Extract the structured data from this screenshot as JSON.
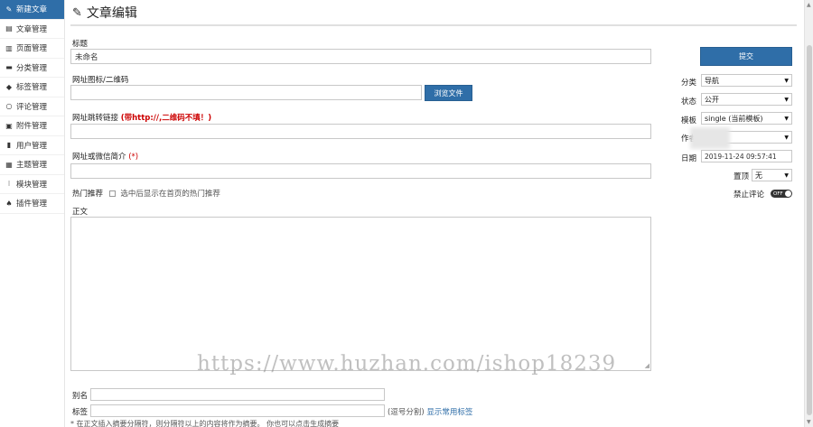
{
  "sidebar": {
    "items": [
      {
        "label": "新建文章",
        "icon": "pencil-icon"
      },
      {
        "label": "文章管理",
        "icon": "document-icon"
      },
      {
        "label": "页面管理",
        "icon": "page-icon"
      },
      {
        "label": "分类管理",
        "icon": "folder-icon"
      },
      {
        "label": "标签管理",
        "icon": "tag-icon"
      },
      {
        "label": "评论管理",
        "icon": "comment-icon"
      },
      {
        "label": "附件管理",
        "icon": "attachment-icon"
      },
      {
        "label": "用户管理",
        "icon": "user-icon"
      },
      {
        "label": "主题管理",
        "icon": "theme-icon"
      },
      {
        "label": "模块管理",
        "icon": "module-icon"
      },
      {
        "label": "插件管理",
        "icon": "plugin-icon"
      }
    ]
  },
  "header": {
    "title": "文章编辑"
  },
  "form": {
    "title_label": "标题",
    "title_value": "未命名",
    "icon_label": "网址图标/二维码",
    "browse_button": "浏览文件",
    "jump_label": "网址跳转链接",
    "jump_note": "(带http://,二维码不填！)",
    "desc_label": "网址或微信简介",
    "desc_required": "(*)",
    "hot_label": "热门推荐",
    "hot_checkbox_text": "选中后显示在首页的热门推荐",
    "body_label": "正文",
    "alias_label": "别名",
    "tags_label": "标签",
    "tags_hint": "(逗号分割)",
    "tags_link": "显示常用标签"
  },
  "panel": {
    "submit_button": "提交",
    "category_label": "分类",
    "category_value": "导航",
    "status_label": "状态",
    "status_value": "公开",
    "template_label": "模板",
    "template_value": "single (当前模板)",
    "author_label": "作者",
    "date_label": "日期",
    "date_value": "2019-11-24 09:57:41",
    "top_label": "置顶",
    "top_value": "无",
    "disable_comment_label": "禁止评论",
    "toggle_text": "OFF"
  },
  "watermark": "https://www.huzhan.com/ishop18239",
  "footnote": "* 在正文插入摘要分隔符，则分隔符以上的内容将作为摘要。 你也可以点击生成摘要"
}
